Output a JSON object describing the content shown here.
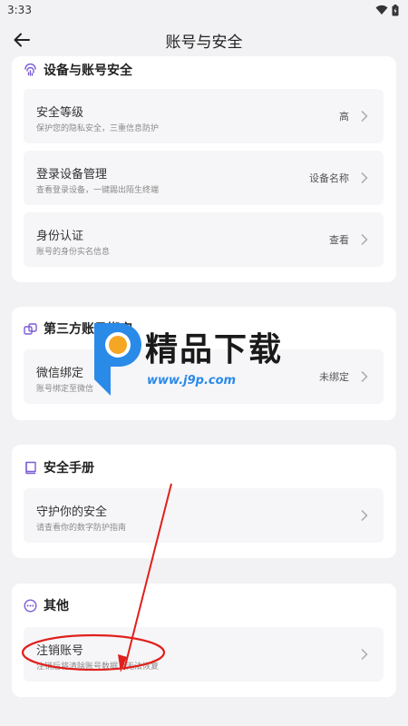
{
  "status_bar": {
    "time": "3:33"
  },
  "nav": {
    "title": "账号与安全"
  },
  "sections": {
    "device": {
      "title": "设备与账号安全",
      "rows": [
        {
          "title": "安全等级",
          "subtitle": "保护您的隐私安全，三重信息防护",
          "value": "高"
        },
        {
          "title": "登录设备管理",
          "subtitle": "查看登录设备，一键踢出陌生终端",
          "value": "设备名称"
        },
        {
          "title": "身份认证",
          "subtitle": "账号的身份实名信息",
          "value": "查看"
        }
      ]
    },
    "third_party": {
      "title": "第三方账号绑定",
      "rows": [
        {
          "title": "微信绑定",
          "subtitle": "账号绑定至微信",
          "value": "未绑定"
        }
      ]
    },
    "manual": {
      "title": "安全手册",
      "rows": [
        {
          "title": "守护你的安全",
          "subtitle": "请查看你的数字防护指南"
        }
      ]
    },
    "other": {
      "title": "其他",
      "rows": [
        {
          "title": "注销账号",
          "subtitle": "注销后将清除账号数据且无法恢复"
        }
      ]
    }
  },
  "watermark": {
    "text": "精品下载",
    "url": "www.j9p.com"
  },
  "colors": {
    "accent": "#7b5cd6",
    "annotation": "#e0201c",
    "watermark_url": "#2a8ae8"
  },
  "icons": {
    "back": "arrow-left-icon",
    "device": "fingerprint-icon",
    "third_party": "link-squares-icon",
    "manual": "book-icon",
    "other": "more-circle-icon",
    "chevron": "chevron-right-icon"
  }
}
